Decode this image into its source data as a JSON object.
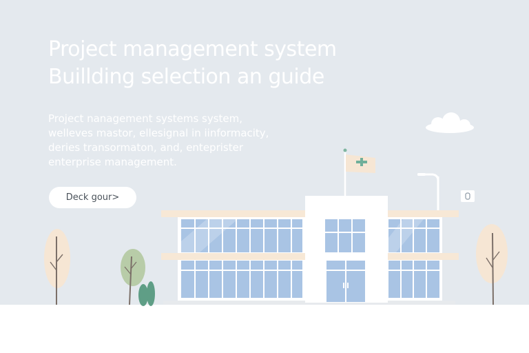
{
  "hero": {
    "title_lines": [
      "Project management system",
      "Buillding selection an guide"
    ],
    "description_lines": [
      "Project nanagement systems system,",
      "welleves mastor, ellesignal in iinformacity,",
      "deries transormaton, and, enteprister",
      "enterprise management."
    ],
    "cta_label": "Deck gour>"
  },
  "colors": {
    "background": "#e4e9ee",
    "glass": "#a9c4e4",
    "building": "#ffffff",
    "trim": "#f7e8d6",
    "tree_green": "#b8cca8",
    "tree_peach": "#f6e6d4",
    "shrub": "#5f9e86"
  },
  "icons": {
    "flag": "medical-cross-flag",
    "cloud": "cloud",
    "lamp": "street-lamp",
    "sign": "small-sign"
  }
}
